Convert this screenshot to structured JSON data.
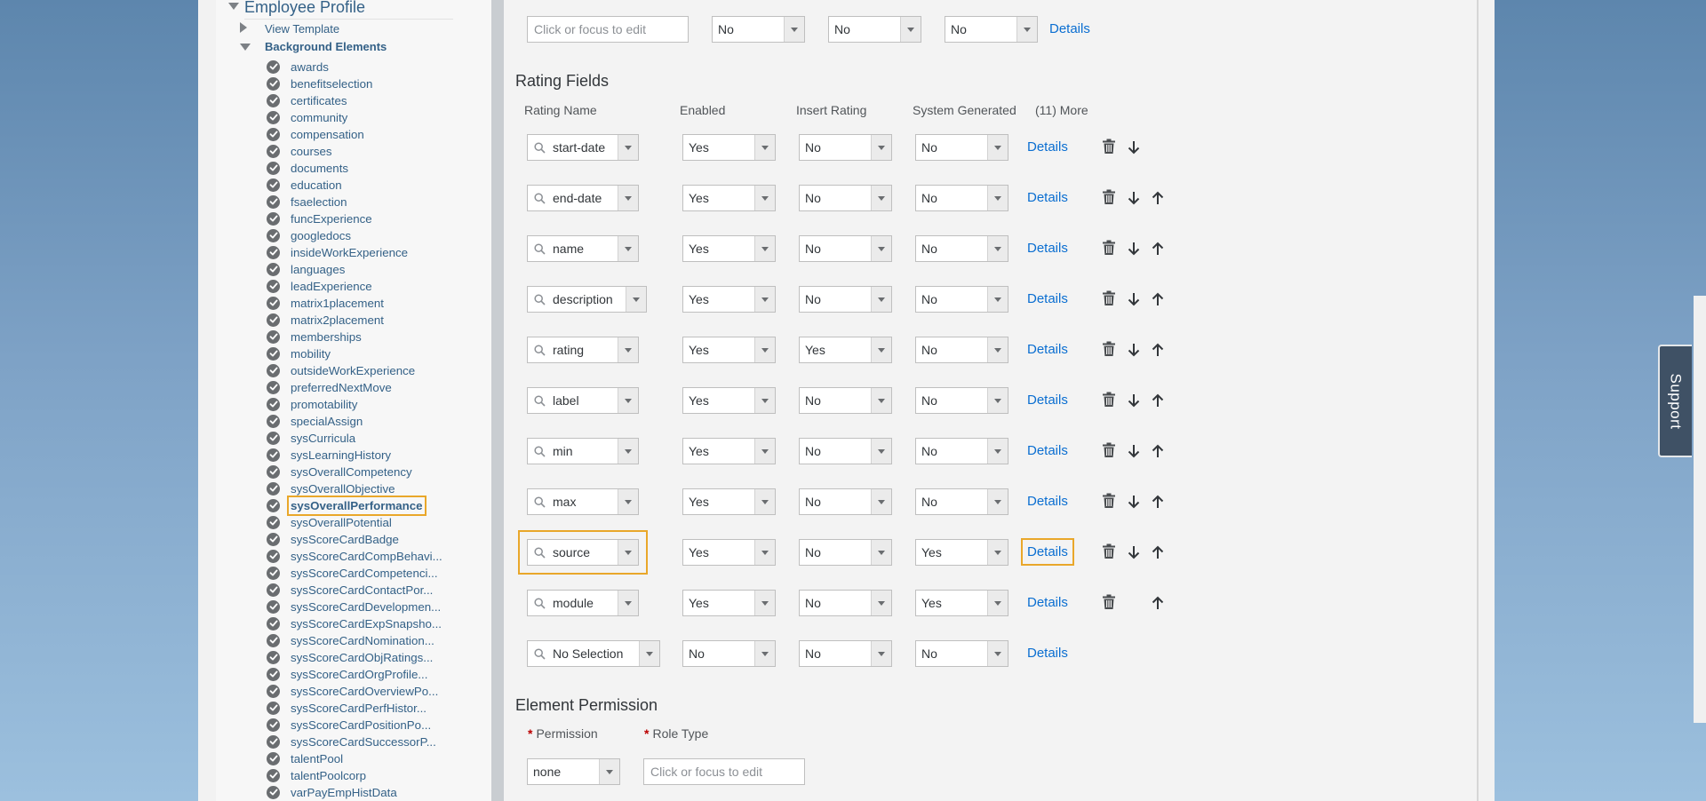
{
  "sidebar": {
    "title": "Employee Profile",
    "view_template": "View Template",
    "background_elements": "Background Elements",
    "items": [
      "awards",
      "benefitselection",
      "certificates",
      "community",
      "compensation",
      "courses",
      "documents",
      "education",
      "fsaelection",
      "funcExperience",
      "googledocs",
      "insideWorkExperience",
      "languages",
      "leadExperience",
      "matrix1placement",
      "matrix2placement",
      "memberships",
      "mobility",
      "outsideWorkExperience",
      "preferredNextMove",
      "promotability",
      "specialAssign",
      "sysCurricula",
      "sysLearningHistory",
      "sysOverallCompetency",
      "sysOverallObjective",
      "sysOverallPerformance",
      "sysOverallPotential",
      "sysScoreCardBadge",
      "sysScoreCardCompBehavi...",
      "sysScoreCardCompetenci...",
      "sysScoreCardContactPor...",
      "sysScoreCardDevelopmen...",
      "sysScoreCardExpSnapsho...",
      "sysScoreCardNomination...",
      "sysScoreCardObjRatings...",
      "sysScoreCardOrgProfile...",
      "sysScoreCardOverviewPo...",
      "sysScoreCardPerfHistor...",
      "sysScoreCardPositionPo...",
      "sysScoreCardSuccessorP...",
      "talentPool",
      "talentPoolcorp",
      "varPayEmpHistData"
    ],
    "selected": "sysOverallPerformance"
  },
  "top_row": {
    "input_placeholder": "Click or focus to edit",
    "values": [
      "No",
      "No",
      "No"
    ],
    "details": "Details"
  },
  "rating_fields": {
    "title": "Rating Fields",
    "headers": {
      "name": "Rating Name",
      "enabled": "Enabled",
      "insert": "Insert Rating",
      "system": "System Generated",
      "more": "(11) More"
    },
    "rows": [
      {
        "name": "start-date",
        "enabled": "Yes",
        "insert": "No",
        "system": "No",
        "details": "Details"
      },
      {
        "name": "end-date",
        "enabled": "Yes",
        "insert": "No",
        "system": "No",
        "details": "Details"
      },
      {
        "name": "name",
        "enabled": "Yes",
        "insert": "No",
        "system": "No",
        "details": "Details"
      },
      {
        "name": "description",
        "enabled": "Yes",
        "insert": "No",
        "system": "No",
        "details": "Details"
      },
      {
        "name": "rating",
        "enabled": "Yes",
        "insert": "Yes",
        "system": "No",
        "details": "Details"
      },
      {
        "name": "label",
        "enabled": "Yes",
        "insert": "No",
        "system": "No",
        "details": "Details"
      },
      {
        "name": "min",
        "enabled": "Yes",
        "insert": "No",
        "system": "No",
        "details": "Details"
      },
      {
        "name": "max",
        "enabled": "Yes",
        "insert": "No",
        "system": "No",
        "details": "Details"
      },
      {
        "name": "source",
        "enabled": "Yes",
        "insert": "No",
        "system": "Yes",
        "details": "Details"
      },
      {
        "name": "module",
        "enabled": "Yes",
        "insert": "No",
        "system": "Yes",
        "details": "Details"
      },
      {
        "name": "No Selection",
        "enabled": "No",
        "insert": "No",
        "system": "No",
        "details": "Details"
      }
    ]
  },
  "element_permission": {
    "title": "Element Permission",
    "permission_label": "Permission",
    "role_type_label": "Role Type",
    "permission_value": "none",
    "role_type_placeholder": "Click or focus to edit"
  },
  "support": "Support"
}
